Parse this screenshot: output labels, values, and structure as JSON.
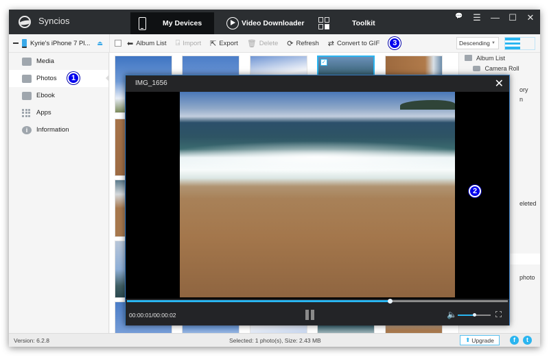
{
  "app": {
    "title": "Syncios",
    "nav_tabs": [
      {
        "label": "My Devices",
        "active": true,
        "icon": "phone-icon"
      },
      {
        "label": "Video Downloader",
        "active": false,
        "icon": "play-circle-icon"
      },
      {
        "label": "Toolkit",
        "active": false,
        "icon": "toolkit-grid-icon"
      }
    ],
    "window_controls": {
      "feedback": "💬",
      "menu": "☰",
      "minimize": "—",
      "maximize": "☐",
      "close": "✕"
    }
  },
  "device": {
    "name": "Kyrie's iPhone 7 Pl...",
    "eject_icon": "⏏"
  },
  "toolbar": {
    "album_list": "Album List",
    "import": "Import",
    "export": "Export",
    "delete": "Delete",
    "refresh": "Refresh",
    "convert_gif": "Convert to GIF",
    "sort": "Descending",
    "sort_caret": "▼"
  },
  "sidebar": {
    "items": [
      {
        "label": "Media",
        "active": false
      },
      {
        "label": "Photos",
        "active": true
      },
      {
        "label": "Ebook",
        "active": false
      },
      {
        "label": "Apps",
        "active": false
      },
      {
        "label": "Information",
        "active": false
      }
    ],
    "info_glyph": "i"
  },
  "right_panel": {
    "album_list": "Album List",
    "camera_roll": "Camera Roll",
    "partial_1": "ory",
    "partial_2": "n",
    "partial_3": "eleted",
    "partial_4": "photo"
  },
  "badges": [
    "1",
    "2",
    "3"
  ],
  "viewer": {
    "title": "IMG_1656",
    "close": "✕",
    "time": "00:00:01/00:00:02",
    "progress": 0.69,
    "volume": 0.5,
    "volume_icon": "🔊"
  },
  "status": {
    "version": "Version: 6.2.8",
    "selected": "Selected: 1 photo(s), Size: 2.43 MB",
    "upgrade": "Upgrade",
    "upgrade_icon": "⬆",
    "facebook": "f",
    "twitter": "t"
  },
  "colors": {
    "accent": "#2ab5f0",
    "titlebar": "#2b2e31",
    "badge": "#0000ee"
  }
}
